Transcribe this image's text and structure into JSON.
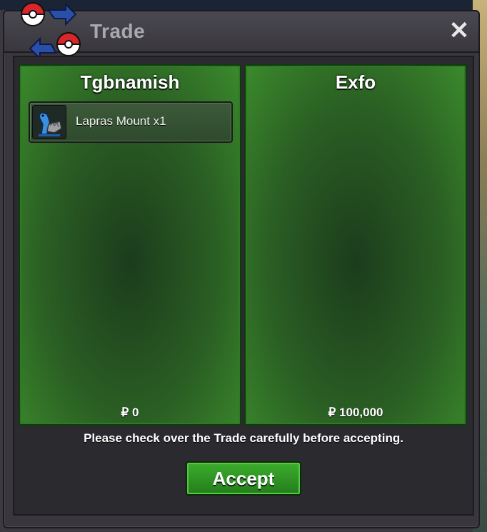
{
  "window": {
    "title": "Trade",
    "close_label": "✕"
  },
  "players": {
    "left": {
      "name": "Tgbnamish",
      "items": [
        {
          "label": "Lapras Mount  x1",
          "icon": "lapras-icon"
        }
      ],
      "money": "₽ 0"
    },
    "right": {
      "name": "Exfo",
      "items": [],
      "money": "₽ 100,000"
    }
  },
  "notice": "Please check over the Trade carefully before accepting.",
  "accept_label": "Accept",
  "colors": {
    "panel_green": "#2a5e23",
    "button_green": "#3cae2c",
    "window_bg": "#39373d"
  }
}
